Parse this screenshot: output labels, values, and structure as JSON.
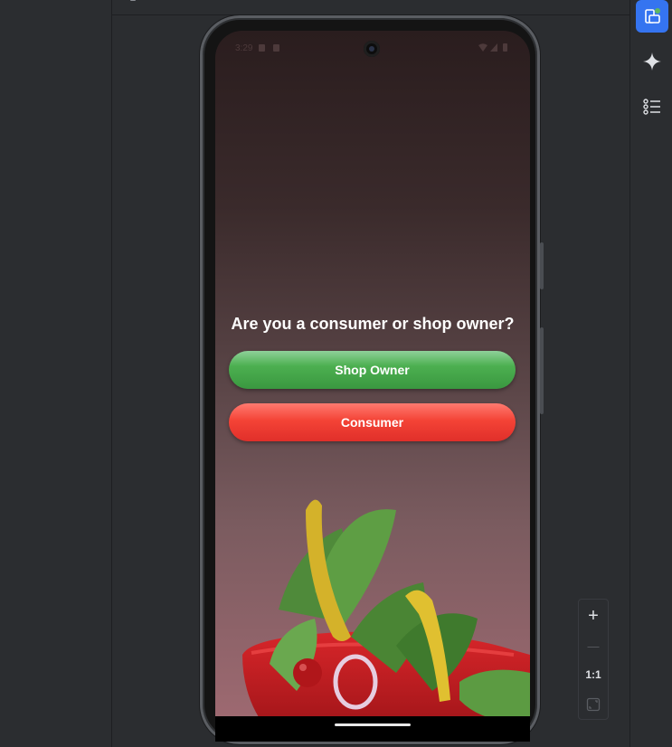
{
  "app": {
    "question": "Are you a consumer or shop owner?",
    "buttons": {
      "shop_owner": "Shop Owner",
      "consumer": "Consumer"
    }
  },
  "status_bar": {
    "time": "3:29"
  },
  "toolbar": {
    "items": [
      {
        "icon": "running-devices-icon",
        "active": true
      },
      {
        "icon": "gemini-sparkle-icon",
        "active": false
      },
      {
        "icon": "list-icon",
        "active": false
      }
    ]
  },
  "zoom": {
    "zoom_in": "+",
    "zoom_out": "—",
    "actual_size": "1:1",
    "fit": "fit-screen-icon"
  },
  "colors": {
    "shop_owner": "#4caf50",
    "consumer": "#f44336",
    "accent": "#3574f0"
  }
}
